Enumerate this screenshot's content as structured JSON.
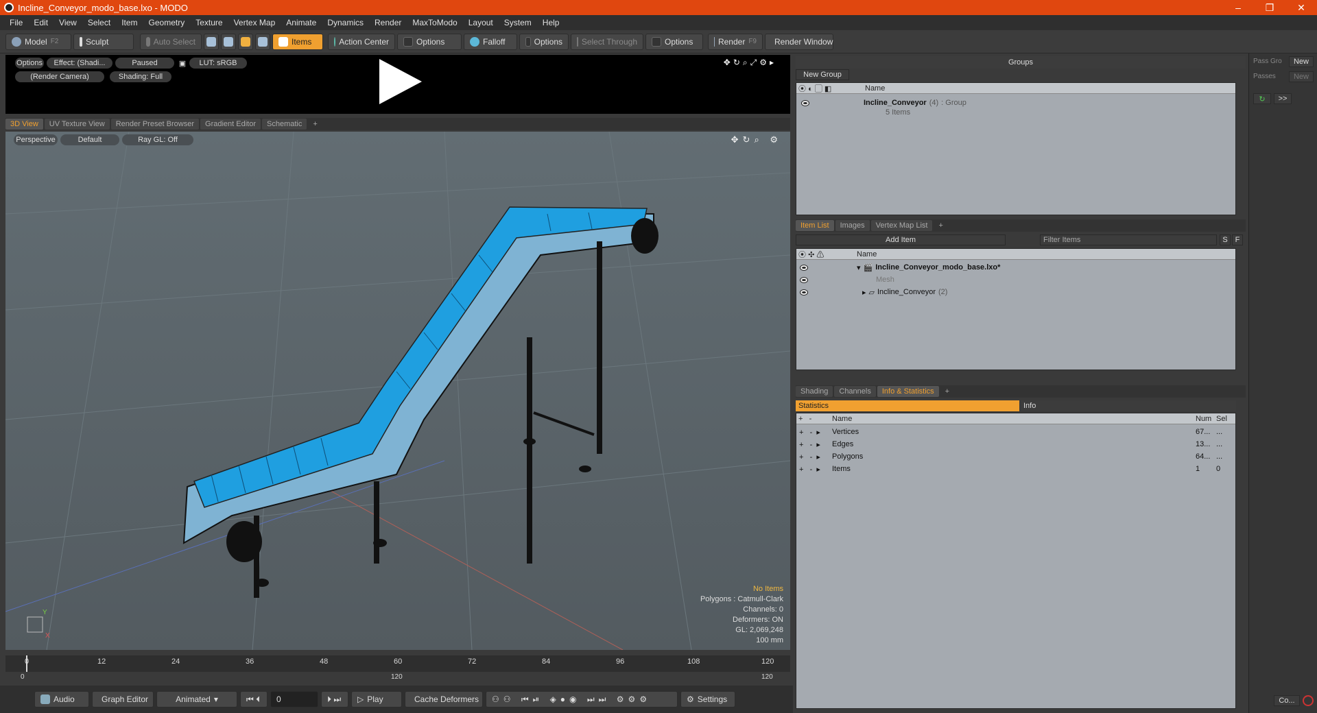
{
  "window": {
    "title": "Incline_Conveyor_modo_base.lxo - MODO",
    "minimize": "–",
    "maximize": "❐",
    "close": "✕"
  },
  "menu": [
    "File",
    "Edit",
    "View",
    "Select",
    "Item",
    "Geometry",
    "Texture",
    "Vertex Map",
    "Animate",
    "Dynamics",
    "Render",
    "MaxToModo",
    "Layout",
    "System",
    "Help"
  ],
  "toolbar": {
    "model": "Model",
    "model_key": "F2",
    "sculpt": "Sculpt",
    "auto_select": "Auto Select",
    "items": "Items",
    "action_center": "Action Center",
    "options1": "Options",
    "falloff": "Falloff",
    "options2": "Options",
    "select_through": "Select Through",
    "options3": "Options",
    "render": "Render",
    "render_key": "F9",
    "render_window": "Render Window"
  },
  "preview": {
    "options": "Options",
    "effect": "Effect: (Shadi...",
    "paused": "Paused",
    "lut": "LUT: sRGB",
    "camera": "(Render Camera)",
    "shading": "Shading: Full"
  },
  "viewtabs": [
    "3D View",
    "UV Texture View",
    "Render Preset Browser",
    "Gradient Editor",
    "Schematic",
    "+"
  ],
  "viewport": {
    "perspective": "Perspective",
    "default": "Default",
    "raygl": "Ray GL: Off",
    "hud": [
      "No Items",
      "Polygons : Catmull-Clark",
      "Channels: 0",
      "Deformers: ON",
      "GL: 2,069,248",
      "100 mm"
    ]
  },
  "timeline": {
    "ticks": [
      "0",
      "12",
      "24",
      "36",
      "48",
      "60",
      "72",
      "84",
      "96",
      "108",
      "120"
    ],
    "range_start": "0",
    "range_mid": "120",
    "range_end": "120"
  },
  "bottombar": {
    "audio": "Audio",
    "graph_editor": "Graph Editor",
    "animated": "Animated",
    "frame": "0",
    "play": "Play",
    "cache": "Cache Deformers",
    "settings": "Settings"
  },
  "groups": {
    "title": "Groups",
    "new_group": "New Group",
    "col_name": "Name",
    "item_name": "Incline_Conveyor",
    "item_count": "(4)",
    "item_type": ": Group",
    "item_sub": "5 Items"
  },
  "itemlist": {
    "tabs": [
      "Item List",
      "Images",
      "Vertex Map List",
      "+"
    ],
    "add_item": "Add Item",
    "filter": "Filter Items",
    "s": "S",
    "f": "F",
    "col_name": "Name",
    "rows": [
      {
        "name": "Incline_Conveyor_modo_base.lxo*",
        "extra": ""
      },
      {
        "name": "Mesh",
        "extra": ""
      },
      {
        "name": "Incline_Conveyor",
        "extra": "(2)"
      }
    ]
  },
  "stats": {
    "tabs": [
      "Shading",
      "Channels",
      "Info & Statistics",
      "+"
    ],
    "statistics": "Statistics",
    "info": "Info",
    "col_name": "Name",
    "col_num": "Num",
    "col_sel": "Sel",
    "rows": [
      {
        "name": "Vertices",
        "num": "67...",
        "sel": "..."
      },
      {
        "name": "Edges",
        "num": "13...",
        "sel": "..."
      },
      {
        "name": "Polygons",
        "num": "64...",
        "sel": "..."
      },
      {
        "name": "Items",
        "num": "1",
        "sel": "0"
      }
    ]
  },
  "passes": {
    "pass_group": "Pass Gro",
    "passes": "Passes",
    "new1": "New",
    "new2": "New",
    "more": ">>",
    "co": "Co..."
  },
  "colors": {
    "accent": "#f0a030",
    "titlebar": "#e0470f",
    "belt": "#1f9fe0",
    "frame": "#7fb3d3"
  }
}
